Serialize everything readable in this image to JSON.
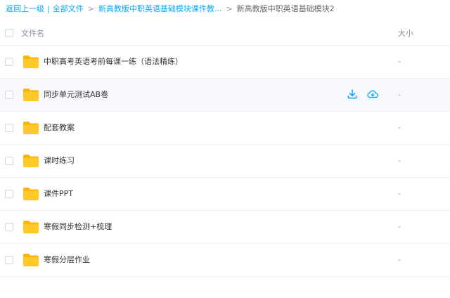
{
  "breadcrumb": {
    "back": "返回上一级",
    "sep_bar": "|",
    "all_files": "全部文件",
    "parent": "新高教版中职英语基础模块课件教...",
    "sep_gt": ">",
    "current": "新高教版中职英语基础模块2"
  },
  "header": {
    "name_col": "文件名",
    "size_col": "大小"
  },
  "files": [
    {
      "name": "中职高考英语考前每课一练（语法精练）",
      "size": "-",
      "icon": "folder-icon"
    },
    {
      "name": "同步单元测试AB卷",
      "size": "-",
      "icon": "folder-icon"
    },
    {
      "name": "配套教案",
      "size": "-",
      "icon": "folder-icon"
    },
    {
      "name": "课时练习",
      "size": "-",
      "icon": "folder-icon"
    },
    {
      "name": "课件PPT",
      "size": "-",
      "icon": "folder-icon"
    },
    {
      "name": "寒假同步检测+梳理",
      "size": "-",
      "icon": "folder-icon"
    },
    {
      "name": "寒假分层作业",
      "size": "-",
      "icon": "folder-icon"
    }
  ],
  "row_actions": [
    "download-icon",
    "cloud-save-icon"
  ],
  "colors": {
    "link": "#06a7ff",
    "folder_body": "#ffca28",
    "folder_tab": "#ffb300",
    "hover_row": "#f7f9fc"
  }
}
